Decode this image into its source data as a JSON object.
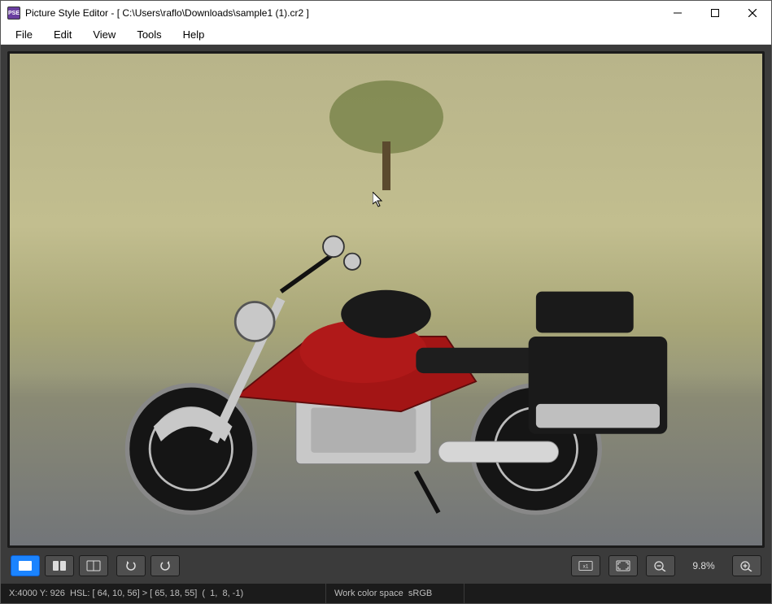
{
  "window": {
    "app_icon_label": "PSE",
    "title": "Picture Style Editor - [ C:\\Users\\raflo\\Downloads\\sample1 (1).cr2 ]"
  },
  "menubar": {
    "file": "File",
    "edit": "Edit",
    "view": "View",
    "tools": "Tools",
    "help": "Help"
  },
  "toolbar": {
    "view_single": "single-view",
    "view_split": "split-view",
    "view_compare": "compare-view",
    "rotate_ccw": "rotate-ccw",
    "rotate_cw": "rotate-cw",
    "actual_size": "x1",
    "fit": "fit",
    "zoom_out": "zoom-out",
    "zoom_label": "9.8%",
    "zoom_in": "zoom-in"
  },
  "statusbar": {
    "coords_hsl": "X:4000 Y: 926  HSL: [ 64, 10, 56] > [ 65, 18, 55]  (  1,  8, -1)",
    "color_space": "Work color space  sRGB"
  }
}
